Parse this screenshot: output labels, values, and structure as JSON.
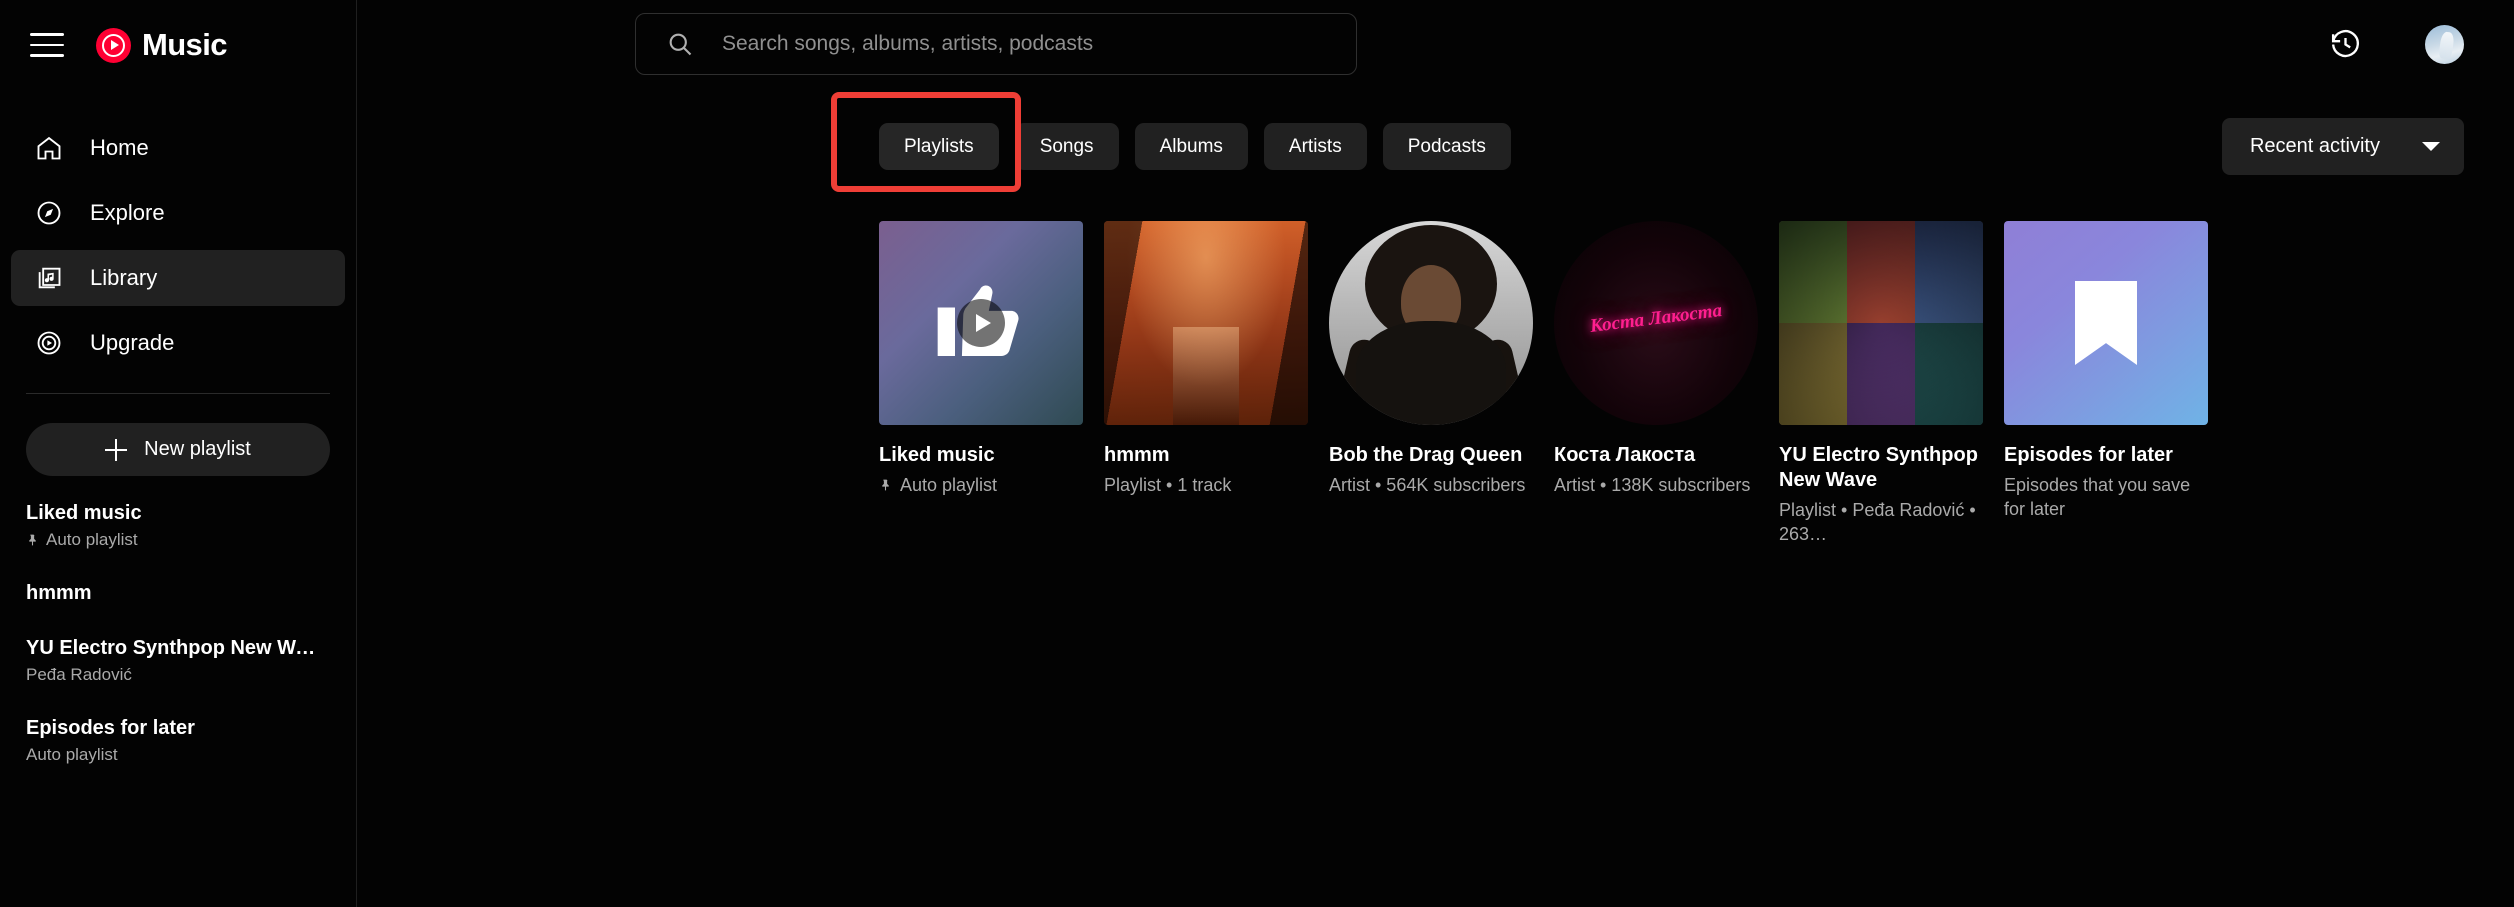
{
  "sidebar": {
    "logo_text": "Music",
    "nav": [
      {
        "label": "Home",
        "icon": "home-icon",
        "active": false
      },
      {
        "label": "Explore",
        "icon": "compass-icon",
        "active": false
      },
      {
        "label": "Library",
        "icon": "library-icon",
        "active": true
      },
      {
        "label": "Upgrade",
        "icon": "upgrade-icon",
        "active": false
      }
    ],
    "new_playlist_label": "New playlist",
    "playlists": [
      {
        "title": "Liked music",
        "subtitle": "Auto playlist",
        "pinned": true
      },
      {
        "title": "hmmm",
        "subtitle": "",
        "pinned": false
      },
      {
        "title": "YU Electro Synthpop New Wa…",
        "subtitle": "Peđa Radović",
        "pinned": false
      },
      {
        "title": "Episodes for later",
        "subtitle": "Auto playlist",
        "pinned": false
      }
    ]
  },
  "topbar": {
    "search_placeholder": "Search songs, albums, artists, podcasts",
    "search_value": "",
    "history_icon": "history-icon",
    "avatar": "account-avatar"
  },
  "filters": {
    "chips": [
      {
        "label": "Playlists",
        "selected": true
      },
      {
        "label": "Songs",
        "selected": false
      },
      {
        "label": "Albums",
        "selected": false
      },
      {
        "label": "Artists",
        "selected": false
      },
      {
        "label": "Podcasts",
        "selected": false
      }
    ],
    "highlight_color": "#ef3e36",
    "sort_label": "Recent activity"
  },
  "cards": [
    {
      "title": "Liked music",
      "subtitle": "Auto playlist",
      "pinned": true,
      "thumb": "liked-music-thumbnail"
    },
    {
      "title": "hmmm",
      "subtitle": "Playlist • 1 track",
      "pinned": false,
      "thumb": "hmmm-playlist-thumbnail"
    },
    {
      "title": "Bob the Drag Queen",
      "subtitle": "Artist • 564K subscribers",
      "pinned": false,
      "thumb": "bob-the-drag-queen-avatar"
    },
    {
      "title": "Коста Лакоста",
      "subtitle": "Artist • 138K subscribers",
      "pinned": false,
      "thumb": "kosta-lakosta-avatar",
      "art_text": "Коста Лакоста"
    },
    {
      "title": "YU Electro Synthpop New Wave",
      "subtitle": "Playlist • Peđa Radović • 263…",
      "pinned": false,
      "thumb": "yu-electro-synthpop-thumbnail"
    },
    {
      "title": "Episodes for later",
      "subtitle": "Episodes that you save for later",
      "pinned": false,
      "thumb": "episodes-for-later-thumbnail"
    }
  ]
}
